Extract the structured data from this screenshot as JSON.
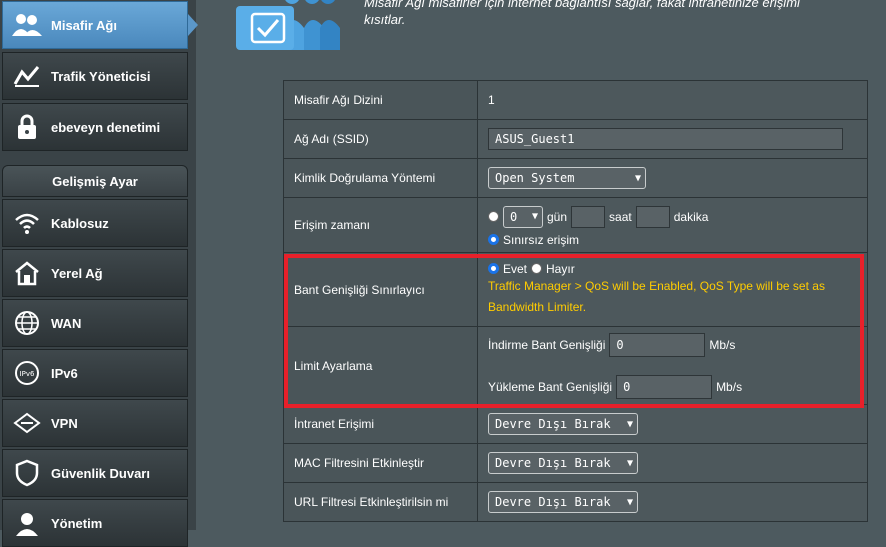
{
  "sidebar": {
    "items_top": [
      {
        "label": "Misafir Ağı",
        "icon": "users-icon",
        "active": true
      },
      {
        "label": "Trafik Yöneticisi",
        "icon": "traffic-chart-icon"
      },
      {
        "label": "ebeveyn denetimi",
        "icon": "lock-icon"
      }
    ],
    "section_title": "Gelişmiş Ayar",
    "items_advanced": [
      {
        "label": "Kablosuz",
        "icon": "wifi-icon"
      },
      {
        "label": "Yerel Ağ",
        "icon": "home-icon"
      },
      {
        "label": "WAN",
        "icon": "globe-icon"
      },
      {
        "label": "IPv6",
        "icon": "ipv6-icon"
      },
      {
        "label": "VPN",
        "icon": "vpn-icon"
      },
      {
        "label": "Güvenlik Duvarı",
        "icon": "shield-icon"
      },
      {
        "label": "Yönetim",
        "icon": "admin-icon"
      }
    ]
  },
  "header": {
    "line1": "Misafir Ağı misafirler için internet bağlantısı sağlar, fakat intranetinize erişimi",
    "line2": "kısıtlar."
  },
  "settings": {
    "index_label": "Misafir Ağı Dizini",
    "index_value": "1",
    "ssid_label": "Ağ Adı (SSID)",
    "ssid_value": "ASUS_Guest1",
    "auth_label": "Kimlik Doğrulama Yöntemi",
    "auth_value": "Open System",
    "access_label": "Erişim zamanı",
    "days_value": "0",
    "days_unit": "gün",
    "hours_unit": "saat",
    "minutes_unit": "dakika",
    "unlimited_label": "Sınırsız erişim",
    "bw_label": "Bant Genişliği Sınırlayıcı",
    "bw_yes": "Evet",
    "bw_no": "Hayır",
    "bw_warning_1": "Traffic Manager > QoS will be Enabled, QoS Type will be set as",
    "bw_warning_2": "Bandwidth Limiter.",
    "limit_label": "Limit Ayarlama",
    "download_label": "İndirme Bant Genişliği",
    "download_value": "0",
    "upload_label": "Yükleme Bant Genişliği",
    "upload_value": "0",
    "rate_unit": "Mb/s",
    "intranet_label": "İntranet Erişimi",
    "intranet_value": "Devre Dışı Bırak",
    "mac_label": "MAC Filtresini Etkinleştir",
    "mac_value": "Devre Dışı Bırak",
    "url_label": "URL Filtresi Etkinleştirilsin mi",
    "url_value": "Devre Dışı Bırak"
  },
  "colors": {
    "accent": "#5b97c9",
    "highlight": "#e8202a",
    "warning": "#ffcc00"
  }
}
